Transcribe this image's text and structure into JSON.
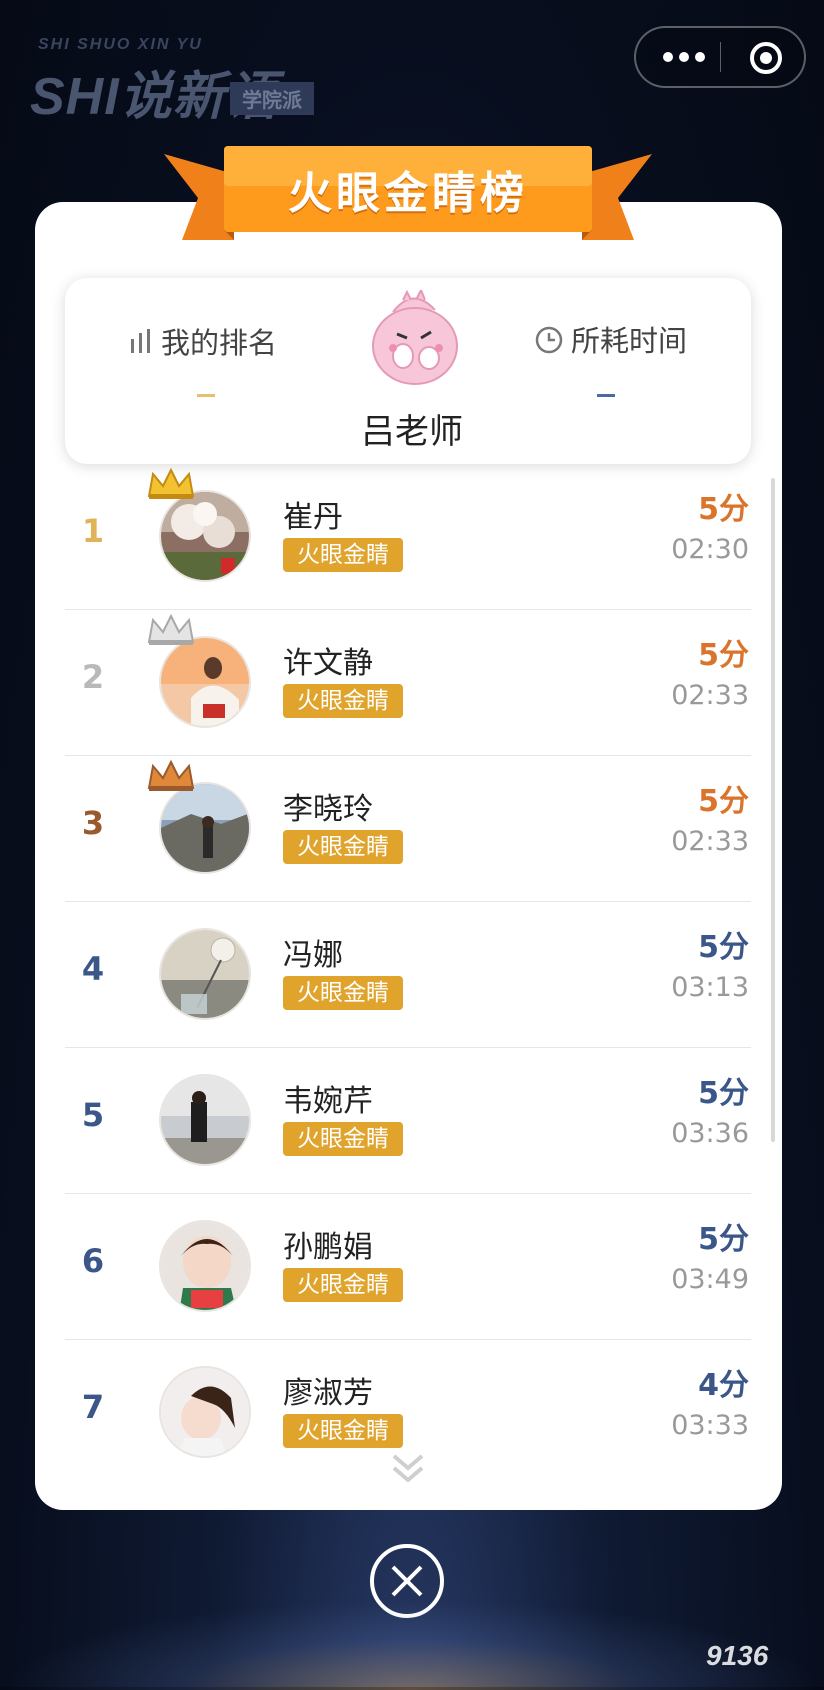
{
  "brand": {
    "top": "SHI SHUO XIN YU",
    "main": "SHI说新语",
    "sub": "学院派"
  },
  "banner": {
    "title": "火眼金睛榜"
  },
  "me": {
    "rank_label": "我的排名",
    "rank_value": "–",
    "time_label": "所耗时间",
    "time_value": "–",
    "name": "吕老师"
  },
  "colors": {
    "gold": "#e0a32c",
    "orange_score": "#d9742a",
    "blue_score": "#3b5688",
    "silver": "#b9b9b9",
    "bronze": "#9a5a2e"
  },
  "leaderboard": [
    {
      "rank": "1",
      "name": "崔丹",
      "tag": "火眼金睛",
      "score": "5分",
      "time": "02:30",
      "medal": "gold"
    },
    {
      "rank": "2",
      "name": "许文静",
      "tag": "火眼金睛",
      "score": "5分",
      "time": "02:33",
      "medal": "silver"
    },
    {
      "rank": "3",
      "name": "李晓玲",
      "tag": "火眼金睛",
      "score": "5分",
      "time": "02:33",
      "medal": "bronze"
    },
    {
      "rank": "4",
      "name": "冯娜",
      "tag": "火眼金睛",
      "score": "5分",
      "time": "03:13",
      "medal": ""
    },
    {
      "rank": "5",
      "name": "韦婉芹",
      "tag": "火眼金睛",
      "score": "5分",
      "time": "03:36",
      "medal": ""
    },
    {
      "rank": "6",
      "name": "孙鹏娟",
      "tag": "火眼金睛",
      "score": "5分",
      "time": "03:49",
      "medal": ""
    },
    {
      "rank": "7",
      "name": "廖淑芳",
      "tag": "火眼金睛",
      "score": "4分",
      "time": "03:33",
      "medal": ""
    }
  ],
  "watermark": "9136"
}
